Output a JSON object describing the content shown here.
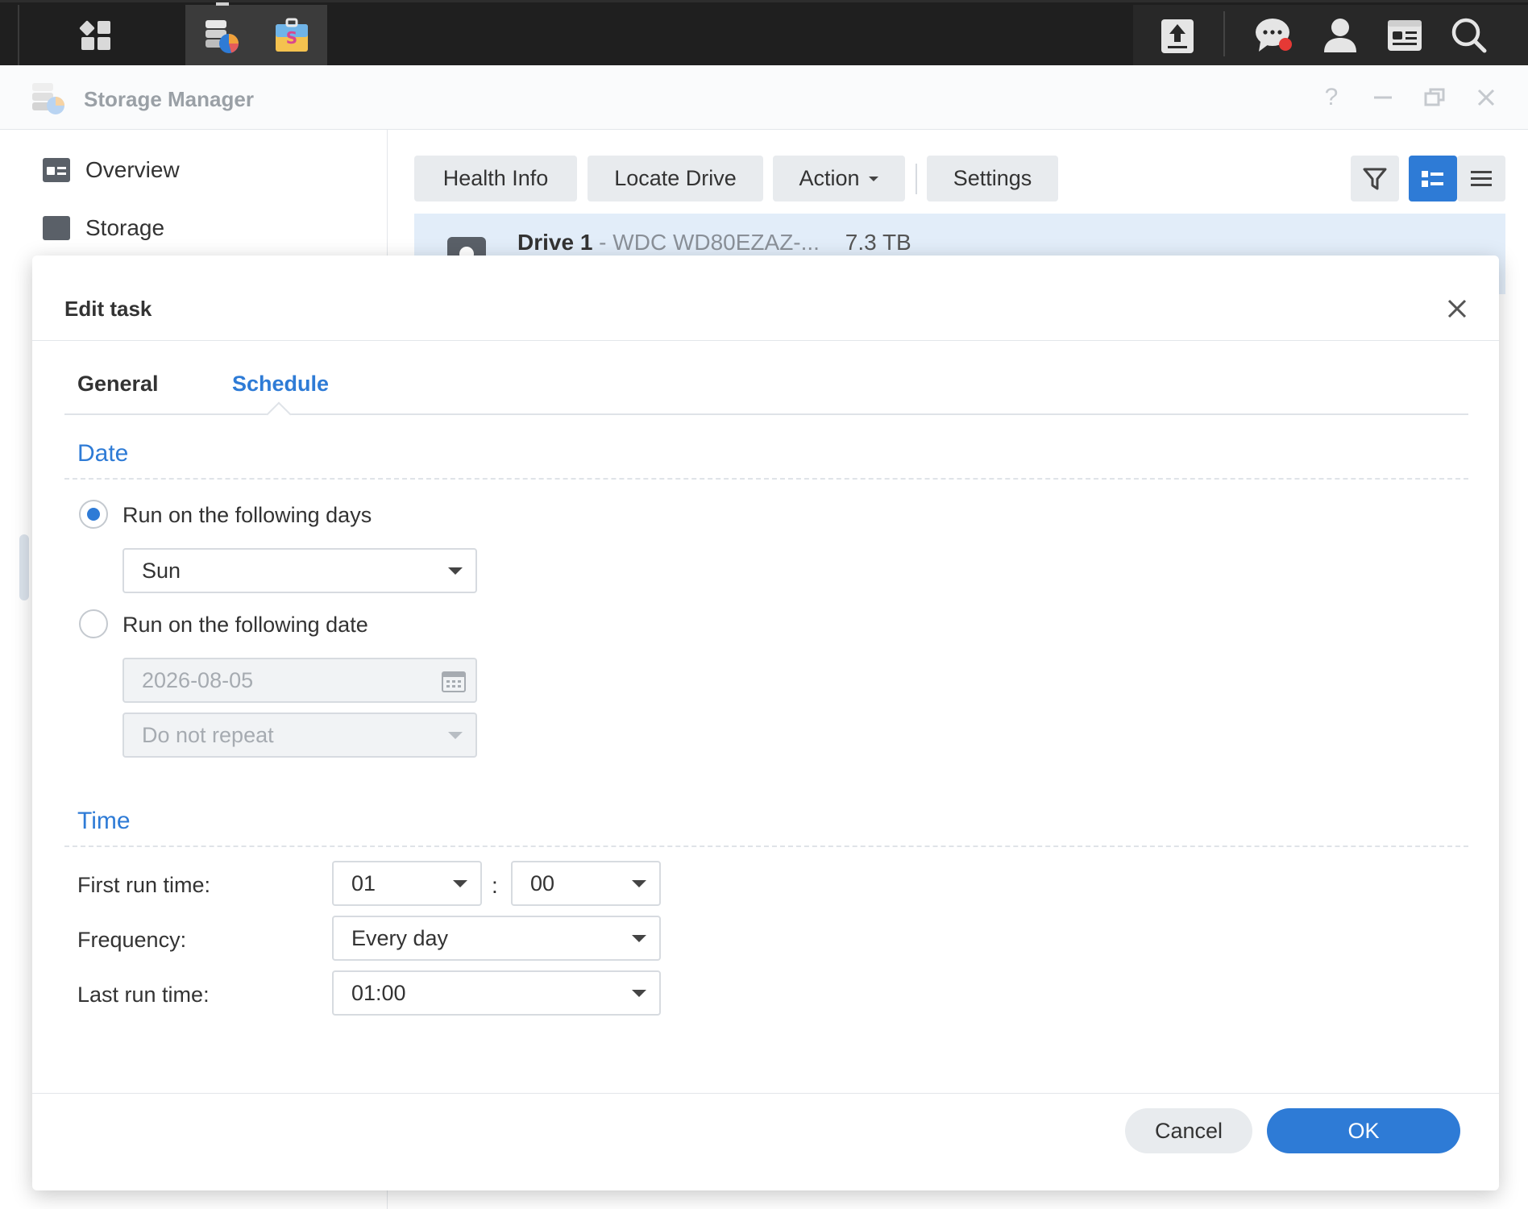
{
  "taskbar": {
    "left_icons": [
      "main-menu-icon",
      "storage-manager-app-icon",
      "package-center-app-icon"
    ],
    "right_icons": [
      "upload-icon",
      "chat-icon",
      "user-icon",
      "widgets-icon",
      "search-icon"
    ],
    "notification_color": "#e53935"
  },
  "window": {
    "title": "Storage Manager",
    "help": "?",
    "sidebar": {
      "items": [
        {
          "label": "Overview",
          "icon": "overview-icon"
        },
        {
          "label": "Storage",
          "icon": "storage-icon"
        }
      ]
    },
    "toolbar": {
      "health_info": "Health Info",
      "locate_drive": "Locate Drive",
      "action": "Action",
      "settings": "Settings"
    },
    "drive": {
      "name": "Drive 1",
      "separator": " - ",
      "model": "WDC WD80EZAZ-...",
      "size": "7.3 TB"
    }
  },
  "dialog": {
    "title": "Edit task",
    "tabs": [
      {
        "label": "General",
        "active": false
      },
      {
        "label": "Schedule",
        "active": true
      }
    ],
    "date_section": {
      "title": "Date",
      "option_days": {
        "label": "Run on the following days",
        "checked": true,
        "value": "Sun"
      },
      "option_date": {
        "label": "Run on the following date",
        "checked": false,
        "date_value": "2026-08-05",
        "repeat_value": "Do not repeat"
      }
    },
    "time_section": {
      "title": "Time",
      "first_run_label": "First run time:",
      "first_run_hour": "01",
      "time_separator": ":",
      "first_run_minute": "00",
      "frequency_label": "Frequency:",
      "frequency_value": "Every day",
      "last_run_label": "Last run time:",
      "last_run_value": "01:00"
    },
    "buttons": {
      "cancel": "Cancel",
      "ok": "OK"
    }
  },
  "colors": {
    "accent": "#2e7bd6",
    "taskbar_bg": "#1f1f1f",
    "selected_row": "#e2edf9"
  }
}
